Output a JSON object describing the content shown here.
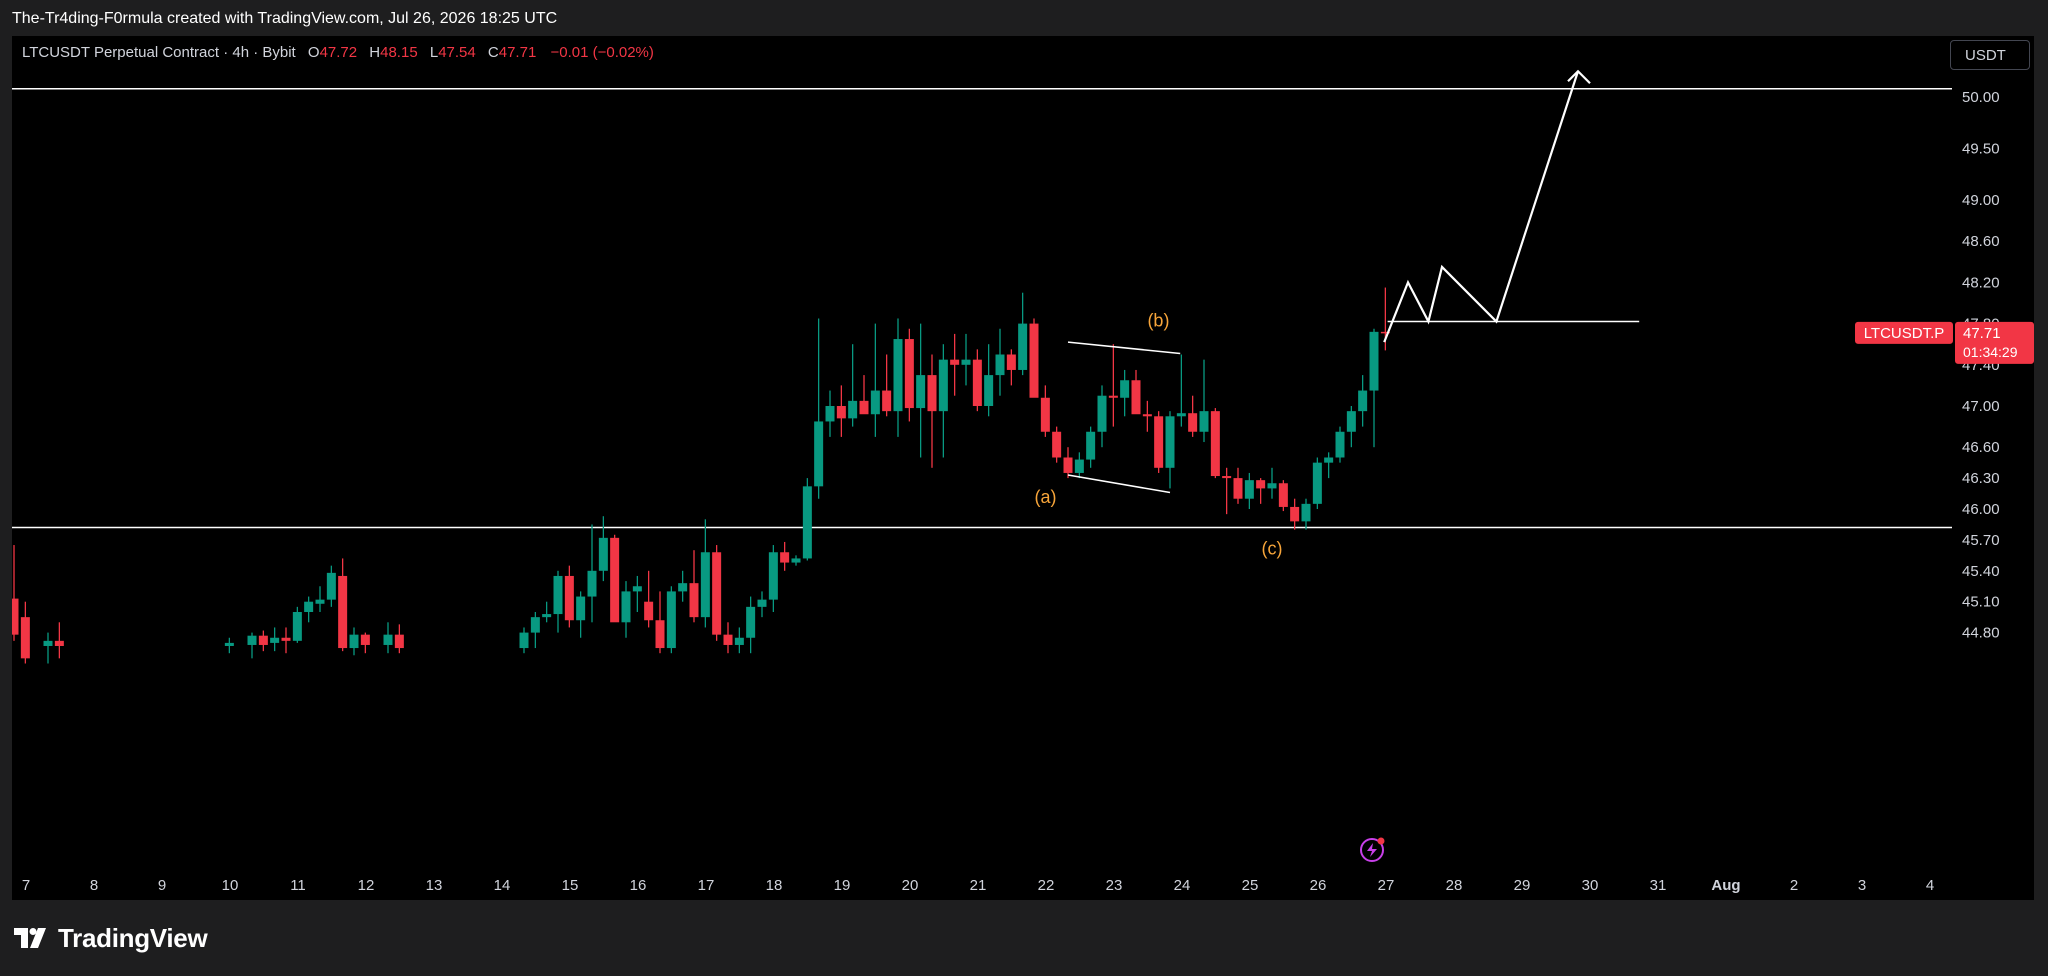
{
  "header": {
    "attribution": "The-Tr4ding-F0rmula created with TradingView.com, Jul 26, 2026 18:25 UTC"
  },
  "legend": {
    "symbol": "LTCUSDT Perpetual Contract · 4h · Bybit",
    "o_label": "O",
    "o_value": "47.72",
    "h_label": "H",
    "h_value": "48.15",
    "l_label": "L",
    "l_value": "47.54",
    "c_label": "C",
    "c_value": "47.71",
    "change": "−0.01 (−0.02%)"
  },
  "currency_button": "USDT",
  "price_tag": {
    "symbol": "LTCUSDT.P",
    "price": "47.71",
    "countdown": "01:34:29"
  },
  "footer": {
    "brand": "TradingView"
  },
  "colors": {
    "up": "#089981",
    "down": "#f23645",
    "annotation": "#f7a53a",
    "line": "#ffffff",
    "background": "#000000"
  },
  "chart_data": {
    "type": "candlestick",
    "y_ticks": [
      "50.00",
      "49.50",
      "49.00",
      "48.60",
      "48.20",
      "47.80",
      "47.40",
      "47.00",
      "46.60",
      "46.30",
      "46.00",
      "45.70",
      "45.40",
      "45.10",
      "44.80"
    ],
    "x_ticks": [
      "7",
      "8",
      "9",
      "10",
      "11",
      "12",
      "13",
      "14",
      "15",
      "16",
      "17",
      "18",
      "19",
      "20",
      "21",
      "22",
      "23",
      "24",
      "25",
      "26",
      "27",
      "28",
      "29",
      "30",
      "31",
      "Aug",
      "2",
      "3",
      "4"
    ],
    "ylim": [
      44.6,
      50.6
    ],
    "horizontal_levels": [
      50.08,
      45.82
    ],
    "wave_labels": [
      "(a)",
      "(b)",
      "(c)"
    ],
    "candles": [
      {
        "d": 7.0,
        "o": 45.13,
        "h": 45.65,
        "l": 44.72,
        "c": 44.78
      },
      {
        "d": 7.167,
        "o": 44.95,
        "h": 45.1,
        "l": 44.5,
        "c": 44.55
      },
      {
        "d": 7.5,
        "o": 44.67,
        "h": 44.8,
        "l": 44.5,
        "c": 44.72
      },
      {
        "d": 7.667,
        "o": 44.72,
        "h": 44.9,
        "l": 44.55,
        "c": 44.67
      },
      {
        "d": 10.167,
        "o": 44.67,
        "h": 44.75,
        "l": 44.6,
        "c": 44.7
      },
      {
        "d": 10.5,
        "o": 44.68,
        "h": 44.8,
        "l": 44.55,
        "c": 44.77
      },
      {
        "d": 10.667,
        "o": 44.77,
        "h": 44.82,
        "l": 44.62,
        "c": 44.68
      },
      {
        "d": 10.833,
        "o": 44.7,
        "h": 44.85,
        "l": 44.62,
        "c": 44.75
      },
      {
        "d": 11.0,
        "o": 44.75,
        "h": 44.85,
        "l": 44.6,
        "c": 44.72
      },
      {
        "d": 11.167,
        "o": 44.72,
        "h": 45.05,
        "l": 44.7,
        "c": 45.0
      },
      {
        "d": 11.333,
        "o": 45.0,
        "h": 45.15,
        "l": 44.9,
        "c": 45.1
      },
      {
        "d": 11.5,
        "o": 45.08,
        "h": 45.25,
        "l": 45.0,
        "c": 45.12
      },
      {
        "d": 11.667,
        "o": 45.12,
        "h": 45.45,
        "l": 45.05,
        "c": 45.38
      },
      {
        "d": 11.833,
        "o": 45.35,
        "h": 45.52,
        "l": 44.62,
        "c": 44.65
      },
      {
        "d": 12.0,
        "o": 44.65,
        "h": 44.85,
        "l": 44.58,
        "c": 44.78
      },
      {
        "d": 12.167,
        "o": 44.78,
        "h": 44.8,
        "l": 44.6,
        "c": 44.68
      },
      {
        "d": 12.5,
        "o": 44.68,
        "h": 44.9,
        "l": 44.6,
        "c": 44.78
      },
      {
        "d": 12.667,
        "o": 44.78,
        "h": 44.88,
        "l": 44.6,
        "c": 44.65
      },
      {
        "d": 14.5,
        "o": 44.65,
        "h": 44.85,
        "l": 44.6,
        "c": 44.8
      },
      {
        "d": 14.667,
        "o": 44.8,
        "h": 45.0,
        "l": 44.65,
        "c": 44.95
      },
      {
        "d": 14.833,
        "o": 44.95,
        "h": 45.1,
        "l": 44.9,
        "c": 44.98
      },
      {
        "d": 15.0,
        "o": 44.98,
        "h": 45.4,
        "l": 44.8,
        "c": 45.35
      },
      {
        "d": 15.167,
        "o": 45.35,
        "h": 45.45,
        "l": 44.85,
        "c": 44.92
      },
      {
        "d": 15.333,
        "o": 44.92,
        "h": 45.2,
        "l": 44.75,
        "c": 45.15
      },
      {
        "d": 15.5,
        "o": 45.15,
        "h": 45.85,
        "l": 44.9,
        "c": 45.4
      },
      {
        "d": 15.667,
        "o": 45.4,
        "h": 45.93,
        "l": 45.3,
        "c": 45.72
      },
      {
        "d": 15.833,
        "o": 45.72,
        "h": 45.75,
        "l": 44.95,
        "c": 44.9
      },
      {
        "d": 16.0,
        "o": 44.9,
        "h": 45.3,
        "l": 44.75,
        "c": 45.2
      },
      {
        "d": 16.167,
        "o": 45.2,
        "h": 45.35,
        "l": 45.0,
        "c": 45.25
      },
      {
        "d": 16.333,
        "o": 45.1,
        "h": 45.4,
        "l": 44.85,
        "c": 44.92
      },
      {
        "d": 16.5,
        "o": 44.92,
        "h": 45.2,
        "l": 44.6,
        "c": 44.65
      },
      {
        "d": 16.667,
        "o": 44.65,
        "h": 45.25,
        "l": 44.6,
        "c": 45.2
      },
      {
        "d": 16.833,
        "o": 45.2,
        "h": 45.4,
        "l": 45.1,
        "c": 45.28
      },
      {
        "d": 17.0,
        "o": 45.28,
        "h": 45.6,
        "l": 44.9,
        "c": 44.95
      },
      {
        "d": 17.167,
        "o": 44.95,
        "h": 45.9,
        "l": 44.85,
        "c": 45.58
      },
      {
        "d": 17.333,
        "o": 45.58,
        "h": 45.65,
        "l": 44.72,
        "c": 44.78
      },
      {
        "d": 17.5,
        "o": 44.78,
        "h": 44.9,
        "l": 44.6,
        "c": 44.68
      },
      {
        "d": 17.667,
        "o": 44.68,
        "h": 44.85,
        "l": 44.6,
        "c": 44.75
      },
      {
        "d": 17.833,
        "o": 44.75,
        "h": 45.15,
        "l": 44.6,
        "c": 45.05
      },
      {
        "d": 18.0,
        "o": 45.05,
        "h": 45.2,
        "l": 44.95,
        "c": 45.12
      },
      {
        "d": 18.167,
        "o": 45.12,
        "h": 45.65,
        "l": 45.0,
        "c": 45.58
      },
      {
        "d": 18.333,
        "o": 45.58,
        "h": 45.68,
        "l": 45.4,
        "c": 45.48
      },
      {
        "d": 18.5,
        "o": 45.48,
        "h": 45.55,
        "l": 45.45,
        "c": 45.52
      },
      {
        "d": 18.667,
        "o": 45.52,
        "h": 46.3,
        "l": 45.5,
        "c": 46.22
      },
      {
        "d": 18.833,
        "o": 46.22,
        "h": 47.85,
        "l": 46.1,
        "c": 46.85
      },
      {
        "d": 19.0,
        "o": 46.85,
        "h": 47.15,
        "l": 46.7,
        "c": 47.0
      },
      {
        "d": 19.167,
        "o": 47.0,
        "h": 47.2,
        "l": 46.7,
        "c": 46.88
      },
      {
        "d": 19.333,
        "o": 46.88,
        "h": 47.6,
        "l": 46.8,
        "c": 47.05
      },
      {
        "d": 19.5,
        "o": 47.05,
        "h": 47.3,
        "l": 46.95,
        "c": 46.92
      },
      {
        "d": 19.667,
        "o": 46.92,
        "h": 47.8,
        "l": 46.7,
        "c": 47.15
      },
      {
        "d": 19.833,
        "o": 47.15,
        "h": 47.5,
        "l": 46.9,
        "c": 46.95
      },
      {
        "d": 20.0,
        "o": 46.95,
        "h": 47.85,
        "l": 46.7,
        "c": 47.65
      },
      {
        "d": 20.167,
        "o": 47.65,
        "h": 47.75,
        "l": 46.85,
        "c": 46.98
      },
      {
        "d": 20.333,
        "o": 46.98,
        "h": 47.8,
        "l": 46.5,
        "c": 47.3
      },
      {
        "d": 20.5,
        "o": 47.3,
        "h": 47.5,
        "l": 46.4,
        "c": 46.95
      },
      {
        "d": 20.667,
        "o": 46.95,
        "h": 47.6,
        "l": 46.5,
        "c": 47.45
      },
      {
        "d": 20.833,
        "o": 47.45,
        "h": 47.7,
        "l": 47.1,
        "c": 47.4
      },
      {
        "d": 21.0,
        "o": 47.4,
        "h": 47.7,
        "l": 47.2,
        "c": 47.45
      },
      {
        "d": 21.167,
        "o": 47.45,
        "h": 47.55,
        "l": 46.95,
        "c": 47.0
      },
      {
        "d": 21.333,
        "o": 47.0,
        "h": 47.6,
        "l": 46.9,
        "c": 47.3
      },
      {
        "d": 21.5,
        "o": 47.3,
        "h": 47.75,
        "l": 47.1,
        "c": 47.5
      },
      {
        "d": 21.667,
        "o": 47.5,
        "h": 47.55,
        "l": 47.2,
        "c": 47.35
      },
      {
        "d": 21.833,
        "o": 47.35,
        "h": 48.1,
        "l": 47.3,
        "c": 47.8
      },
      {
        "d": 22.0,
        "o": 47.8,
        "h": 47.85,
        "l": 47.1,
        "c": 47.08
      },
      {
        "d": 22.167,
        "o": 47.08,
        "h": 47.2,
        "l": 46.7,
        "c": 46.75
      },
      {
        "d": 22.333,
        "o": 46.75,
        "h": 46.8,
        "l": 46.45,
        "c": 46.5
      },
      {
        "d": 22.5,
        "o": 46.5,
        "h": 46.6,
        "l": 46.3,
        "c": 46.35
      },
      {
        "d": 22.667,
        "o": 46.35,
        "h": 46.55,
        "l": 46.3,
        "c": 46.48
      },
      {
        "d": 22.833,
        "o": 46.48,
        "h": 46.8,
        "l": 46.4,
        "c": 46.75
      },
      {
        "d": 23.0,
        "o": 46.75,
        "h": 47.2,
        "l": 46.6,
        "c": 47.1
      },
      {
        "d": 23.167,
        "o": 47.1,
        "h": 47.6,
        "l": 46.8,
        "c": 47.08
      },
      {
        "d": 23.333,
        "o": 47.08,
        "h": 47.35,
        "l": 46.9,
        "c": 47.25
      },
      {
        "d": 23.5,
        "o": 47.25,
        "h": 47.35,
        "l": 46.95,
        "c": 46.92
      },
      {
        "d": 23.667,
        "o": 46.92,
        "h": 47.05,
        "l": 46.75,
        "c": 46.9
      },
      {
        "d": 23.833,
        "o": 46.9,
        "h": 46.95,
        "l": 46.35,
        "c": 46.4
      },
      {
        "d": 24.0,
        "o": 46.4,
        "h": 46.95,
        "l": 46.2,
        "c": 46.9
      },
      {
        "d": 24.167,
        "o": 46.9,
        "h": 47.5,
        "l": 46.8,
        "c": 46.93
      },
      {
        "d": 24.333,
        "o": 46.93,
        "h": 47.1,
        "l": 46.7,
        "c": 46.75
      },
      {
        "d": 24.5,
        "o": 46.75,
        "h": 47.45,
        "l": 46.65,
        "c": 46.95
      },
      {
        "d": 24.667,
        "o": 46.95,
        "h": 46.98,
        "l": 46.3,
        "c": 46.32
      },
      {
        "d": 24.833,
        "o": 46.32,
        "h": 46.4,
        "l": 45.95,
        "c": 46.3
      },
      {
        "d": 25.0,
        "o": 46.3,
        "h": 46.4,
        "l": 46.05,
        "c": 46.1
      },
      {
        "d": 25.167,
        "o": 46.1,
        "h": 46.35,
        "l": 46.0,
        "c": 46.28
      },
      {
        "d": 25.333,
        "o": 46.28,
        "h": 46.3,
        "l": 46.05,
        "c": 46.2
      },
      {
        "d": 25.5,
        "o": 46.2,
        "h": 46.4,
        "l": 46.1,
        "c": 46.25
      },
      {
        "d": 25.667,
        "o": 46.25,
        "h": 46.28,
        "l": 45.98,
        "c": 46.02
      },
      {
        "d": 25.833,
        "o": 46.02,
        "h": 46.1,
        "l": 45.8,
        "c": 45.88
      },
      {
        "d": 26.0,
        "o": 45.88,
        "h": 46.1,
        "l": 45.8,
        "c": 46.05
      },
      {
        "d": 26.167,
        "o": 46.05,
        "h": 46.5,
        "l": 46.0,
        "c": 46.45
      },
      {
        "d": 26.333,
        "o": 46.45,
        "h": 46.55,
        "l": 46.3,
        "c": 46.5
      },
      {
        "d": 26.5,
        "o": 46.5,
        "h": 46.8,
        "l": 46.45,
        "c": 46.75
      },
      {
        "d": 26.667,
        "o": 46.75,
        "h": 47.0,
        "l": 46.6,
        "c": 46.95
      },
      {
        "d": 26.833,
        "o": 46.95,
        "h": 47.3,
        "l": 46.8,
        "c": 47.15
      },
      {
        "d": 27.0,
        "o": 47.15,
        "h": 47.75,
        "l": 46.6,
        "c": 47.72
      },
      {
        "d": 27.167,
        "o": 47.72,
        "h": 48.15,
        "l": 47.54,
        "c": 47.71
      }
    ]
  }
}
